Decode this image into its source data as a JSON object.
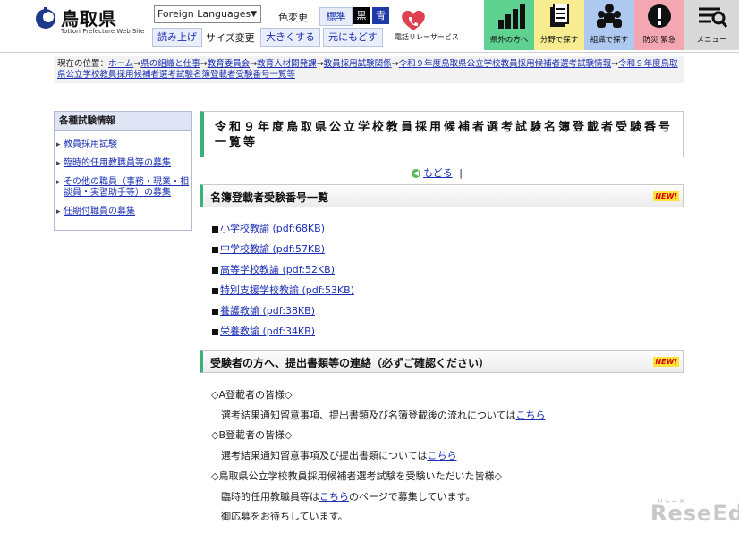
{
  "header": {
    "logo_name": "鳥取県",
    "logo_sub": "Tottori Prefecture Web Site",
    "language_select": "Foreign Languages",
    "color_label": "色変更",
    "color_standard": "標準",
    "color_black": "黒",
    "color_blue": "青",
    "read_aloud": "読み上げ",
    "size_label": "サイズ変更",
    "size_bigger": "大きくする",
    "size_reset": "元にもどす",
    "relay_label": "電話リレーサービス",
    "nav": [
      {
        "label": "県外の方へ",
        "bg": "#5fd190",
        "icon": "bar-chart-icon"
      },
      {
        "label": "分野で探す",
        "bg": "#f7ec8f",
        "icon": "documents-icon"
      },
      {
        "label": "組織で探す",
        "bg": "#aec9ef",
        "icon": "people-icon"
      },
      {
        "label": "防災 緊急",
        "bg": "#f3a7b3",
        "icon": "alert-icon"
      },
      {
        "label": "メニュー",
        "bg": "#d9d9d9",
        "icon": "menu-search-icon"
      }
    ]
  },
  "breadcrumb": {
    "prefix": "現在の位置：",
    "items": [
      "ホーム",
      "県の組織と仕事",
      "教育委員会",
      "教育人材開発課",
      "教員採用試験関係",
      "令和９年度鳥取県公立学校教員採用候補者選考試験情報",
      "令和９年度鳥取県公立学校教員採用候補者選考試験名簿登載者受験番号一覧等"
    ],
    "separator": "→"
  },
  "sidenav": {
    "heading": "各種試験情報",
    "items": [
      "教員採用試験",
      "臨時的任用教職員等の募集",
      "その他の職員（事務・現業・相談員・実習助手等）の募集",
      "任期付職員の募集"
    ]
  },
  "main": {
    "title": "令和９年度鳥取県公立学校教員採用候補者選考試験名簿登載者受験番号一覧等",
    "back_link": "もどる",
    "back_sep": "|",
    "new_badge": "NEW!",
    "section1_title": "名簿登載者受験番号一覧",
    "downloads": [
      "小学校教諭 (pdf:68KB)",
      "中学校教諭 (pdf:57KB)",
      "高等学校教諭 (pdf:52KB)",
      "特別支援学校教諭 (pdf:53KB)",
      "養護教諭 (pdf:38KB)",
      "栄養教諭 (pdf:34KB)"
    ],
    "section2_title": "受験者の方へ、提出書類等の連絡（必ずご確認ください）",
    "notice_a_head": "◇A登載者の皆様◇",
    "notice_a_text": "選考結果通知留意事項、提出書類及び名簿登載後の流れについては",
    "notice_b_head": "◇B登載者の皆様◇",
    "notice_b_text": "選考結果通知留意事項及び提出書類については",
    "notice_c_head": "◇鳥取県公立学校教員採用候補者選考試験を受験いただいた皆様◇",
    "notice_c_text_pre": "臨時的任用教職員等は",
    "notice_c_text_post": "のページで募集しています。",
    "notice_c_text2": "御応募をお待ちしています。",
    "link_here": "こちら"
  },
  "watermark": {
    "text": "ReseEd",
    "small": "リシード"
  }
}
